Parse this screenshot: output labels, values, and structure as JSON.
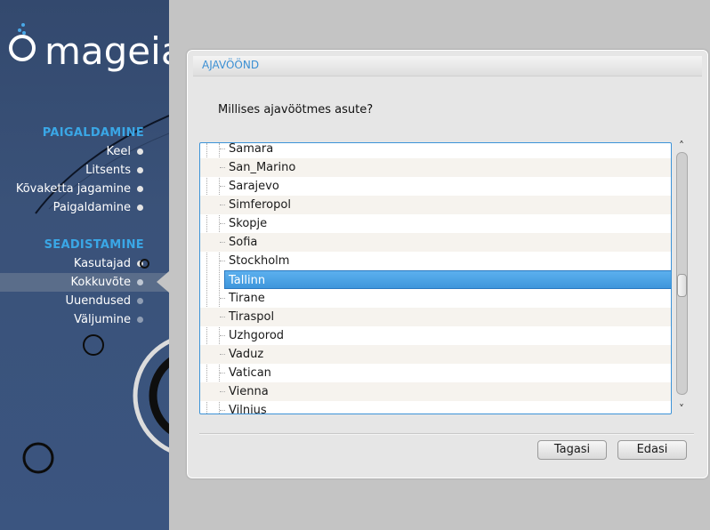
{
  "brand": {
    "logo_text": "mageia"
  },
  "sidebar": {
    "sections": [
      {
        "title": "PAIGALDAMINE",
        "items": [
          {
            "label": "Keel",
            "state": "done"
          },
          {
            "label": "Litsents",
            "state": "done"
          },
          {
            "label": "Kõvaketta jagamine",
            "state": "done"
          },
          {
            "label": "Paigaldamine",
            "state": "done"
          }
        ]
      },
      {
        "title": "SEADISTAMINE",
        "items": [
          {
            "label": "Kasutajad",
            "state": "done"
          },
          {
            "label": "Kokkuvõte",
            "state": "current"
          },
          {
            "label": "Uuendused",
            "state": "pending"
          },
          {
            "label": "Väljumine",
            "state": "pending"
          }
        ]
      }
    ]
  },
  "panel": {
    "title": "AJAVÖÖND",
    "question": "Millises ajavöötmes asute?",
    "timezones": [
      "Samara",
      "San_Marino",
      "Sarajevo",
      "Simferopol",
      "Skopje",
      "Sofia",
      "Stockholm",
      "Tallinn",
      "Tirane",
      "Tiraspol",
      "Uzhgorod",
      "Vaduz",
      "Vatican",
      "Vienna",
      "Vilnius"
    ],
    "selected_timezone": "Tallinn",
    "scroll": {
      "up_glyph": "˄",
      "down_glyph": "˅"
    }
  },
  "buttons": {
    "back": "Tagasi",
    "next": "Edasi"
  },
  "colors": {
    "accent": "#3aa7e6",
    "selection": "#4aa2e4",
    "sidebar": "#3a5279"
  }
}
